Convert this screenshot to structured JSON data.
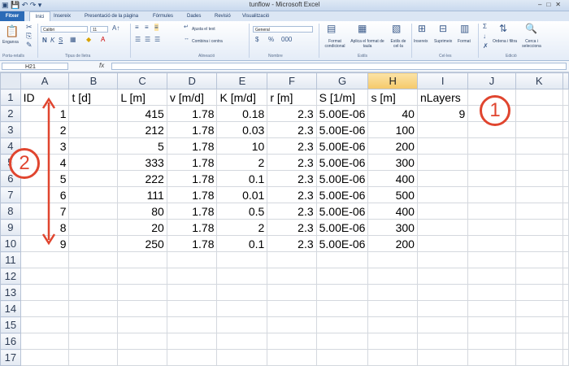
{
  "window": {
    "title": "tunflow - Microsoft Excel"
  },
  "ribbon_tabs": [
    "Fitxer",
    "Inici",
    "Insereix",
    "Presentació de la pàgina",
    "Fórmules",
    "Dades",
    "Revisió",
    "Visualització"
  ],
  "ribbon": {
    "paste_label": "Enganxa",
    "clipboard_group": "Porta-retalls",
    "font_name": "Calibri",
    "font_size": "11",
    "font_group": "Tipus de lletra",
    "wrap_text": "Ajusta el text",
    "merge_center": "Combina i centra",
    "alignment_group": "Alineació",
    "number_format": "General",
    "number_group": "Nombre",
    "conditional_format": "Format condicional",
    "format_as_table": "Aplica el format de taula",
    "cell_styles": "Estils de cel·la",
    "styles_group": "Estils",
    "insert_label": "Insereix",
    "delete_label": "Suprimeix",
    "format_label": "Format",
    "cells_group": "Cel·les",
    "sort_filter": "Ordena i filtra",
    "find_select": "Cerca i selecciona",
    "editing_group": "Edició"
  },
  "formula_bar": {
    "name_box": "H21",
    "fx": "fx",
    "formula": ""
  },
  "sheet": {
    "columns": [
      "A",
      "B",
      "C",
      "D",
      "E",
      "F",
      "G",
      "H",
      "I",
      "J",
      "K"
    ],
    "selected_column": "H",
    "rows": [
      [
        "ID",
        "t [d]",
        "L [m]",
        "v [m/d]",
        "K [m/d]",
        "r [m]",
        "S [1/m]",
        "s [m]",
        "nLayers",
        "",
        ""
      ],
      [
        "1",
        "",
        "415",
        "1.78",
        "0.18",
        "2.3",
        "5.00E-06",
        "40",
        "9",
        "",
        ""
      ],
      [
        "2",
        "",
        "212",
        "1.78",
        "0.03",
        "2.3",
        "5.00E-06",
        "100",
        "",
        "",
        ""
      ],
      [
        "3",
        "",
        "5",
        "1.78",
        "10",
        "2.3",
        "5.00E-06",
        "200",
        "",
        "",
        ""
      ],
      [
        "4",
        "",
        "333",
        "1.78",
        "2",
        "2.3",
        "5.00E-06",
        "300",
        "",
        "",
        ""
      ],
      [
        "5",
        "",
        "222",
        "1.78",
        "0.1",
        "2.3",
        "5.00E-06",
        "400",
        "",
        "",
        ""
      ],
      [
        "6",
        "",
        "111",
        "1.78",
        "0.01",
        "2.3",
        "5.00E-06",
        "500",
        "",
        "",
        ""
      ],
      [
        "7",
        "",
        "80",
        "1.78",
        "0.5",
        "2.3",
        "5.00E-06",
        "400",
        "",
        "",
        ""
      ],
      [
        "8",
        "",
        "20",
        "1.78",
        "2",
        "2.3",
        "5.00E-06",
        "300",
        "",
        "",
        ""
      ],
      [
        "9",
        "",
        "250",
        "1.78",
        "0.1",
        "2.3",
        "5.00E-06",
        "200",
        "",
        "",
        ""
      ],
      [
        "",
        "",
        "",
        "",
        "",
        "",
        "",
        "",
        "",
        "",
        ""
      ],
      [
        "",
        "",
        "",
        "",
        "",
        "",
        "",
        "",
        "",
        "",
        ""
      ],
      [
        "",
        "",
        "",
        "",
        "",
        "",
        "",
        "",
        "",
        "",
        ""
      ],
      [
        "",
        "",
        "",
        "",
        "",
        "",
        "",
        "",
        "",
        "",
        ""
      ],
      [
        "",
        "",
        "",
        "",
        "",
        "",
        "",
        "",
        "",
        "",
        ""
      ],
      [
        "",
        "",
        "",
        "",
        "",
        "",
        "",
        "",
        "",
        "",
        ""
      ],
      [
        "",
        "",
        "",
        "",
        "",
        "",
        "",
        "",
        "",
        "",
        ""
      ]
    ]
  },
  "annotations": {
    "callout_1": "1",
    "callout_2": "2",
    "color": "#e0452f"
  }
}
